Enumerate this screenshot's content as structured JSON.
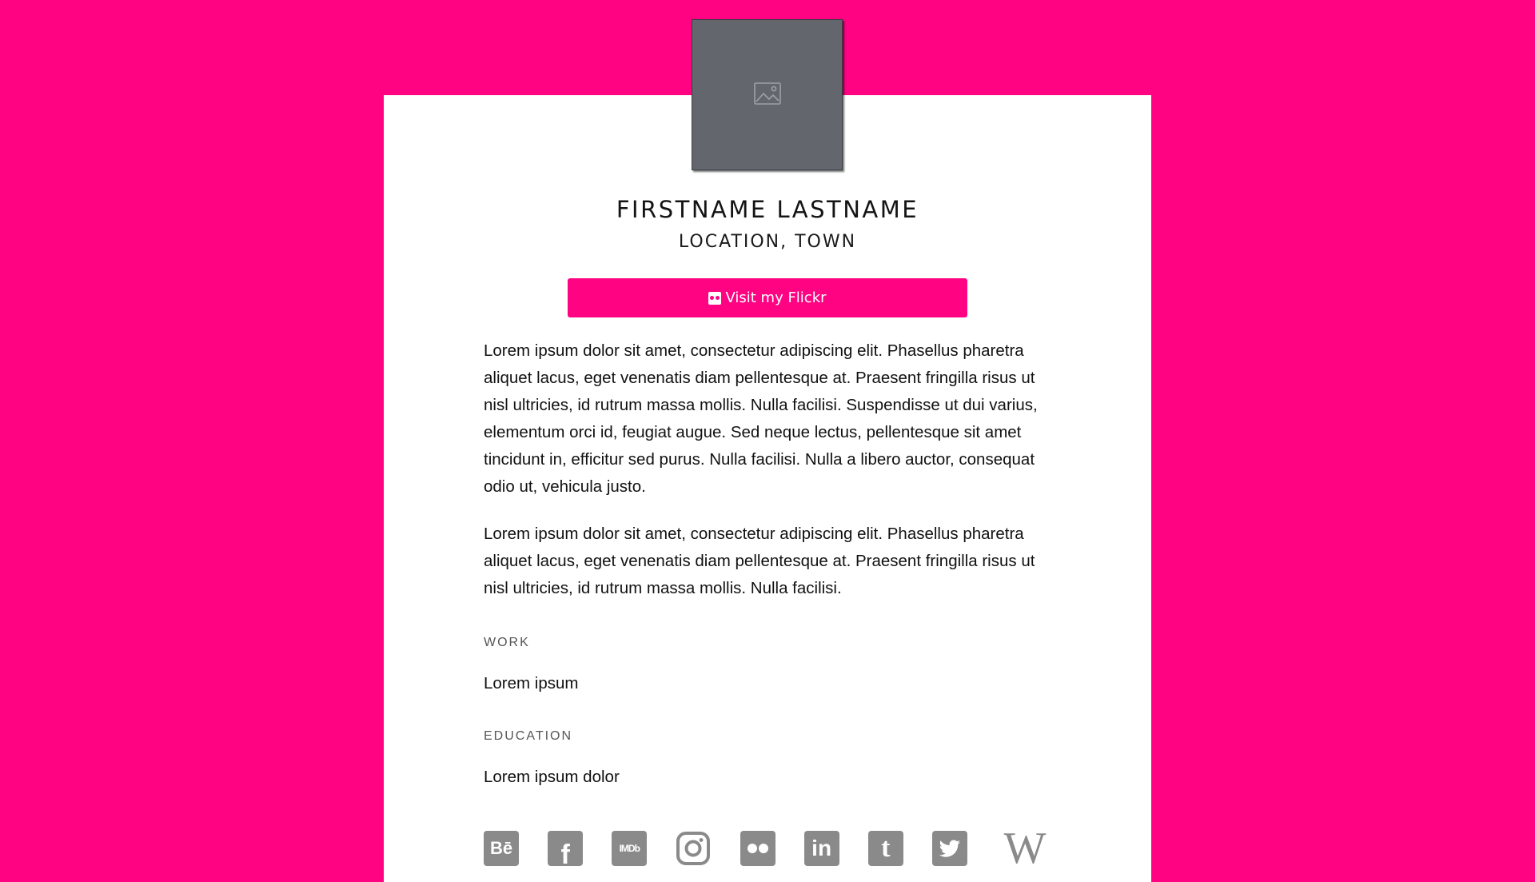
{
  "colors": {
    "background": "#ff0383",
    "card": "#ffffff",
    "accent": "#ff0383",
    "avatar_placeholder": "#63676d",
    "social_icon": "#8a8a8a"
  },
  "profile": {
    "name": "FIRSTNAME LASTNAME",
    "location": "LOCATION, TOWN",
    "avatar_icon": "image-placeholder-icon"
  },
  "button": {
    "icon": "flickr-icon",
    "label": "Visit my Flickr"
  },
  "bio": {
    "paragraphs": [
      "Lorem ipsum dolor sit amet, consectetur adipiscing elit. Phasellus pharetra aliquet lacus, eget venenatis diam pellentesque at. Praesent fringilla risus ut nisl ultricies, id rutrum massa mollis. Nulla facilisi. Suspendisse ut dui varius, elementum orci id, feugiat augue. Sed neque lectus, pellentesque sit amet tincidunt in, efficitur sed purus. Nulla facilisi. Nulla a libero auctor, consequat odio ut, vehicula justo.",
      "Lorem ipsum dolor sit amet, consectetur adipiscing elit. Phasellus pharetra aliquet lacus, eget venenatis diam pellentesque at. Praesent fringilla risus ut nisl ultricies, id rutrum massa mollis. Nulla facilisi."
    ]
  },
  "sections": {
    "work": {
      "label": "WORK",
      "value": "Lorem ipsum"
    },
    "education": {
      "label": "EDUCATION",
      "value": "Lorem ipsum dolor"
    }
  },
  "social": [
    {
      "icon": "behance-icon",
      "glyph": "Bē"
    },
    {
      "icon": "facebook-icon",
      "glyph": "f"
    },
    {
      "icon": "imdb-icon",
      "glyph": "IMDb"
    },
    {
      "icon": "instagram-icon",
      "glyph": ""
    },
    {
      "icon": "flickr-icon",
      "glyph": ""
    },
    {
      "icon": "linkedin-icon",
      "glyph": "in"
    },
    {
      "icon": "tumblr-icon",
      "glyph": "t"
    },
    {
      "icon": "twitter-icon",
      "glyph": ""
    },
    {
      "icon": "wikipedia-icon",
      "glyph": "W"
    }
  ]
}
